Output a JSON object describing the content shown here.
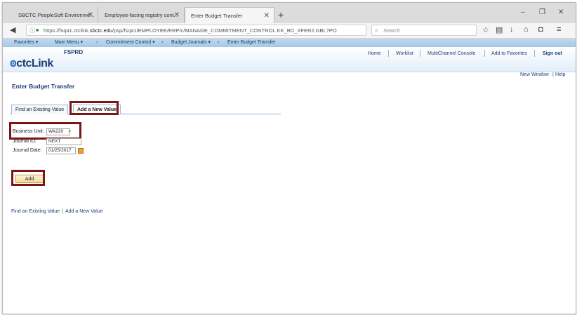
{
  "browser": {
    "tabs": [
      {
        "label": "SBCTC PeopleSoft Environme...",
        "active": false
      },
      {
        "label": "Employee-facing registry cont...",
        "active": false
      },
      {
        "label": "Enter Budget Transfer",
        "active": true
      }
    ],
    "new_tab": "+",
    "window_controls": {
      "minimize": "–",
      "restore": "❐",
      "close": "✕"
    },
    "url_prefix": "https://fsqa1.ctclink.",
    "url_domain": "sbctc.edu",
    "url_suffix": "/psp/fsqa1/EMPLOYEE/ERP/c/MANAGE_COMMITMENT_CONTROL.KK_BD_XFER2.GBL?PO",
    "search_placeholder": "Search"
  },
  "breadcrumb": [
    "Favorites ▾",
    "Main Menu ▾",
    "›",
    "Commitment Control ▾",
    "›",
    "Budget Journals ▾",
    "›",
    "Enter Budget Transfer"
  ],
  "header": {
    "logo_text": "ctcLink",
    "env_name": "FSPRD",
    "links": [
      "Home",
      "Worklist",
      "MultiChannel Console",
      "Add to Favorites",
      "Sign out"
    ]
  },
  "page": {
    "new_window": "New Window",
    "help": "Help",
    "title": "Enter Budget Transfer",
    "tabs": [
      "Find an Existing Value",
      "Add a New Value"
    ],
    "fields": {
      "business_unit_label": "Business Unit:",
      "business_unit_value": "WA220",
      "journal_id_label": "Journal ID:",
      "journal_id_value": "NEXT",
      "journal_date_label": "Journal Date:",
      "journal_date_value": "01/25/2017"
    },
    "add_button": "Add",
    "bottom_links": [
      "Find an Existing Value",
      "Add a New Value"
    ]
  },
  "colors": {
    "highlight": "#7c1518",
    "link": "#1d3e78"
  }
}
